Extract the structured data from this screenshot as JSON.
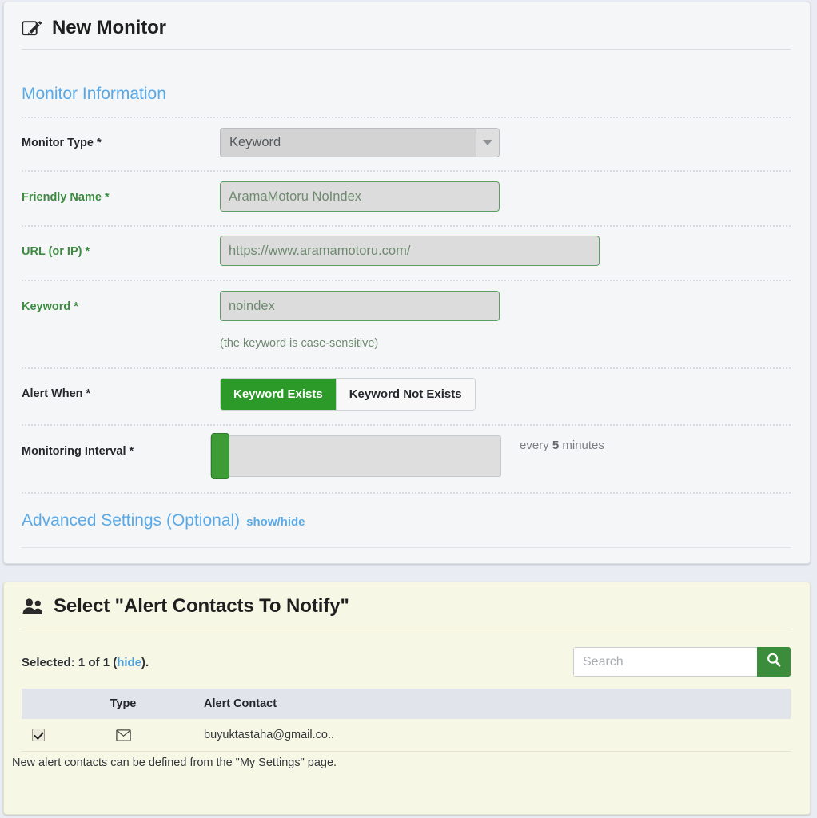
{
  "monitor_panel": {
    "title": "New Monitor",
    "icon": "edit-pencil-square-icon",
    "section_title": "Monitor Information",
    "fields": {
      "monitor_type": {
        "label": "Monitor Type *",
        "value": "Keyword",
        "arrow_icon": "chevron-down-icon"
      },
      "friendly_name": {
        "label": "Friendly Name *",
        "value": "AramaMotoru NoIndex"
      },
      "url": {
        "label": "URL (or IP) *",
        "value": "https://www.aramamotoru.com/"
      },
      "keyword": {
        "label": "Keyword *",
        "value": "noindex",
        "hint": "(the keyword is case-sensitive)"
      },
      "alert_when": {
        "label": "Alert When *",
        "options": [
          "Keyword Exists",
          "Keyword Not Exists"
        ],
        "selected": "Keyword Exists"
      },
      "monitoring_interval": {
        "label": "Monitoring Interval *",
        "value_prefix": "every ",
        "value_number": "5",
        "value_suffix": " minutes"
      }
    },
    "advanced": {
      "label": "Advanced Settings (Optional)",
      "toggle": "show/hide"
    }
  },
  "contacts_panel": {
    "title": "Select \"Alert Contacts To Notify\"",
    "icon": "users-icon",
    "selected_prefix": "Selected: 1 of 1 (",
    "selected_link": "hide",
    "selected_suffix": ").",
    "search": {
      "placeholder": "Search",
      "value": "",
      "button_icon": "magnifier-icon"
    },
    "table": {
      "headers": [
        "",
        "Type",
        "Alert Contact"
      ],
      "rows": [
        {
          "checked": true,
          "type_icon": "envelope-icon",
          "contact": "buyuktastaha@gmail.co.."
        }
      ]
    },
    "footer_note": "New alert contacts can be defined from the \"My Settings\" page."
  },
  "colors": {
    "accent_blue": "#5aa9e6",
    "accent_green": "#2c9a28",
    "label_green": "#3d8b40",
    "panel_cream": "#f7f7e6",
    "panel_grey": "#f5f6f8"
  }
}
